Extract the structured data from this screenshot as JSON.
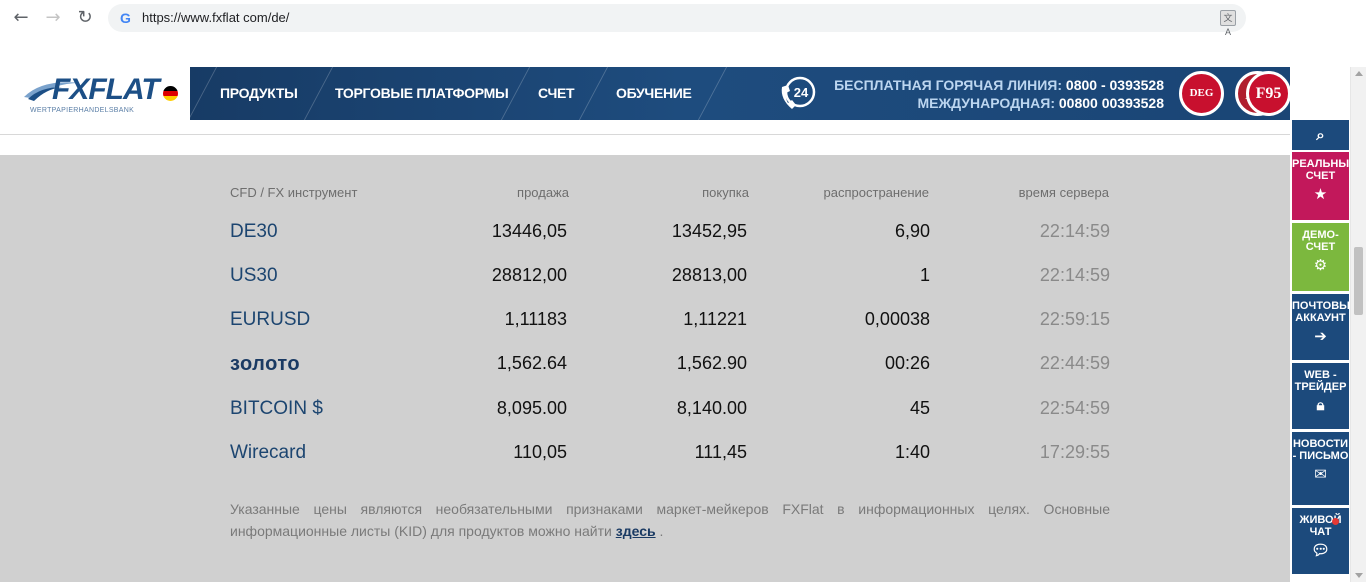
{
  "browser": {
    "url": "https://www.fxflat com/de/",
    "back_icon": "arrow-left-icon",
    "forward_icon": "arrow-right-icon",
    "reload_icon": "reload-icon",
    "favicon": "G"
  },
  "header": {
    "logo": {
      "brand": "FXFLAT",
      "subtitle": "WERTPAPIERHANDELSBANK"
    },
    "nav": [
      "ПРОДУКТЫ",
      "ТОРГОВЫЕ ПЛАТФОРМЫ",
      "СЧЕТ",
      "ОБУЧЕНИЕ"
    ],
    "phone_badge": "24",
    "hotline": {
      "free_label": "БЕСПЛАТНАЯ ГОРЯЧАЯ ЛИНИЯ:",
      "free_number": "0800 - 0393528",
      "intl_label": "МЕЖДУНАРОДНАЯ:",
      "intl_number": "00800 00393528"
    },
    "sponsors": [
      "DEG",
      "RC",
      "F95"
    ]
  },
  "quotes": {
    "columns": [
      "CFD / FX инструмент",
      "продажа",
      "покупка",
      "распространение",
      "время сервера"
    ],
    "rows": [
      {
        "name": "DE30",
        "sell": "13446,05",
        "buy": "13452,95",
        "spread": "6,90",
        "time": "22:14:59"
      },
      {
        "name": "US30",
        "sell": "28812,00",
        "buy": "28813,00",
        "spread": "1",
        "time": "22:14:59"
      },
      {
        "name": "EURUSD",
        "sell": "1,11183",
        "buy": "1,11221",
        "spread": "0,00038",
        "time": "22:59:15"
      },
      {
        "name": "золото",
        "sell": "1,562.64",
        "buy": "1,562.90",
        "spread": "00:26",
        "time": "22:44:59"
      },
      {
        "name": "BITCOIN $",
        "sell": "8,095.00",
        "buy": "8,140.00",
        "spread": "45",
        "time": "22:54:59"
      },
      {
        "name": "Wirecard",
        "sell": "110,05",
        "buy": "111,45",
        "spread": "1:40",
        "time": "17:29:55"
      }
    ],
    "disclaimer": "Указанные цены являются необязательными признаками маркет-мейкеров FXFlat в информационных целях. Основные информационные листы (KID) для продуктов можно найти",
    "disclaimer_link": "здесь",
    "disclaimer_end": " ."
  },
  "side_panel": {
    "search_icon": "search-icon",
    "items": [
      {
        "label": "РЕАЛЬНЫЙ СЧЕТ",
        "icon": "star-icon",
        "color": "#c2185b"
      },
      {
        "label": "ДЕМО-СЧЕТ",
        "icon": "gears-icon",
        "color": "#7cb83e"
      },
      {
        "label": "ПОЧТОВЫЙ АККАУНТ",
        "icon": "login-icon",
        "color": "#1c4a7c"
      },
      {
        "label": "WEB - ТРЕЙДЕР",
        "icon": "lock-icon",
        "color": "#1c4a7c"
      },
      {
        "label": "НОВОСТИ - ПИСЬМО",
        "icon": "envelope-icon",
        "color": "#1c4a7c"
      },
      {
        "label": "ЖИВОЙ ЧАТ",
        "icon": "chat-icon",
        "color": "#1c4a7c"
      }
    ]
  }
}
